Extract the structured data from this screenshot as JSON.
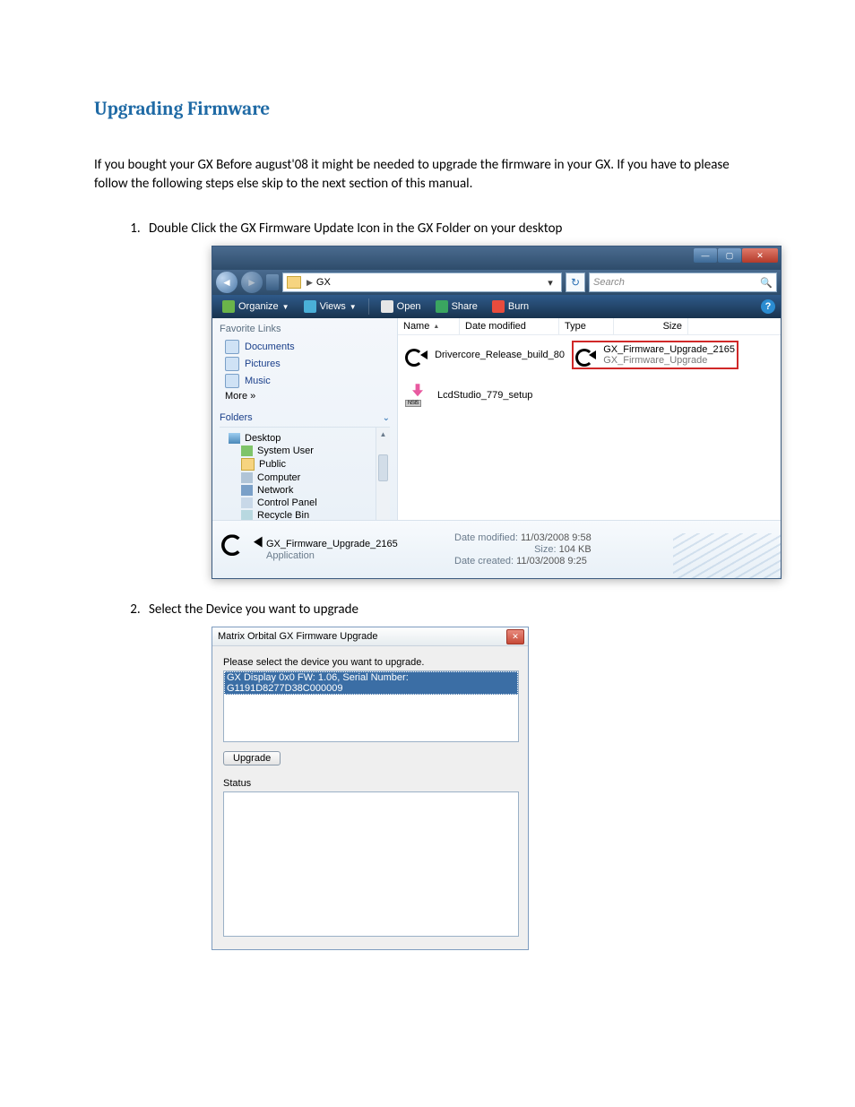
{
  "doc": {
    "heading": "Upgrading Firmware",
    "intro": "If you bought your GX Before august'08 it might be needed to upgrade the firmware in your GX. If you have to please follow the following steps else skip to the next section of this manual.",
    "step1": "Double Click the GX Firmware Update Icon in the GX Folder on your desktop",
    "step2": "Select the Device you want to upgrade"
  },
  "explorer": {
    "path_prefix": "▶",
    "path": "GX",
    "search_placeholder": "Search",
    "toolbar": {
      "organize": "Organize",
      "views": "Views",
      "open": "Open",
      "share": "Share",
      "burn": "Burn"
    },
    "sidebar": {
      "fav_header": "Favorite Links",
      "documents": "Documents",
      "pictures": "Pictures",
      "music": "Music",
      "more": "More  »",
      "folders_header": "Folders",
      "desktop": "Desktop",
      "system_user": "System User",
      "public": "Public",
      "computer": "Computer",
      "network": "Network",
      "control_panel": "Control Panel",
      "recycle_bin": "Recycle Bin"
    },
    "columns": {
      "name": "Name",
      "modified": "Date modified",
      "type": "Type",
      "size": "Size"
    },
    "files": {
      "f1": "Drivercore_Release_build_80",
      "f2_line1": "GX_Firmware_Upgrade_2165",
      "f2_line2": "GX_Firmware_Upgrade",
      "f3": "LcdStudio_779_setup"
    },
    "details": {
      "name": "GX_Firmware_Upgrade_2165",
      "type": "Application",
      "mod_label": "Date modified:",
      "mod": "11/03/2008 9:58",
      "size_label": "Size:",
      "size": "104 KB",
      "created_label": "Date created:",
      "created": "11/03/2008 9:25"
    }
  },
  "dialog": {
    "title": "Matrix Orbital GX Firmware Upgrade",
    "prompt": "Please select the device you want to upgrade.",
    "selected_device": "GX Display 0x0 FW: 1.06, Serial Number: G1191D8277D38C000009",
    "upgrade_btn": "Upgrade",
    "status_label": "Status"
  }
}
